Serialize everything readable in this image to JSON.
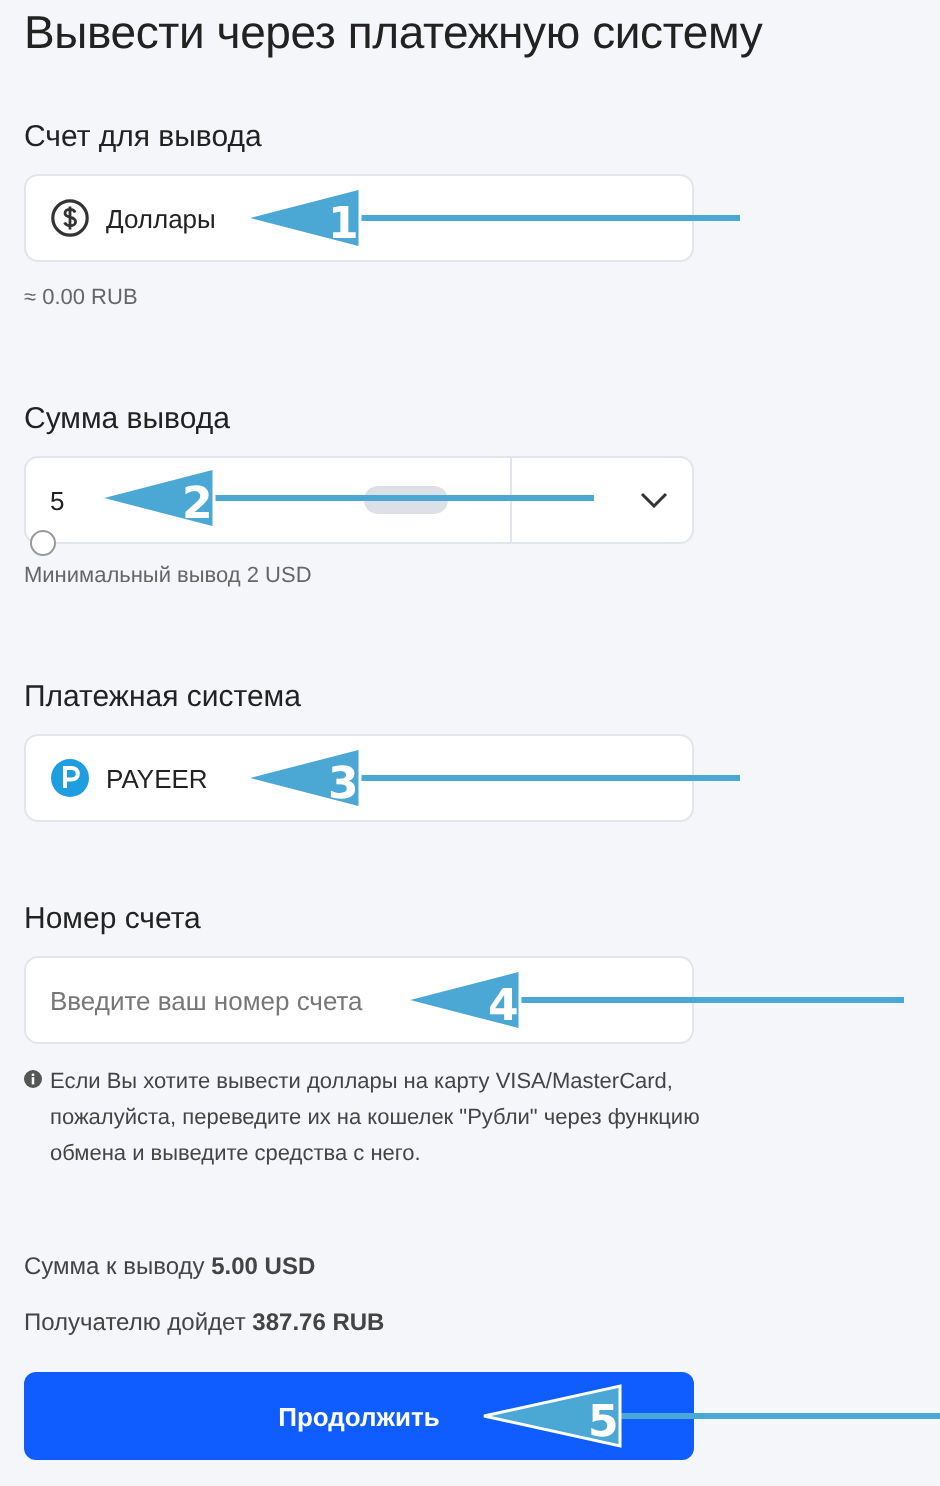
{
  "title": "Вывести через платежную систему",
  "account": {
    "label": "Счет для вывода",
    "currency": "Доллары",
    "annotation": "1",
    "approx": "≈ 0.00 RUB"
  },
  "amount": {
    "label": "Сумма вывода",
    "value": "5",
    "annotation": "2",
    "slider": {
      "level": 0
    },
    "min_note": "Минимальный вывод 2 USD"
  },
  "payment": {
    "label": "Платежная система",
    "system": "PAYEER",
    "annotation": "3"
  },
  "account_number": {
    "label": "Номер счета",
    "placeholder": "Введите ваш номер счета",
    "annotation": "4",
    "note": "Если Вы хотите вывести доллары на карту VISA/MasterCard, пожалуйста, переведите их на кошелек \"Рубли\" через функцию обмена и выведите средства с него."
  },
  "summary": [
    {
      "text": "Сумма к выводу **5.00 USD**"
    },
    {
      "text": "Получателю дойдет **387.76 RUB**"
    }
  ],
  "submit": {
    "label": "Продолжить",
    "annotation": "5"
  }
}
